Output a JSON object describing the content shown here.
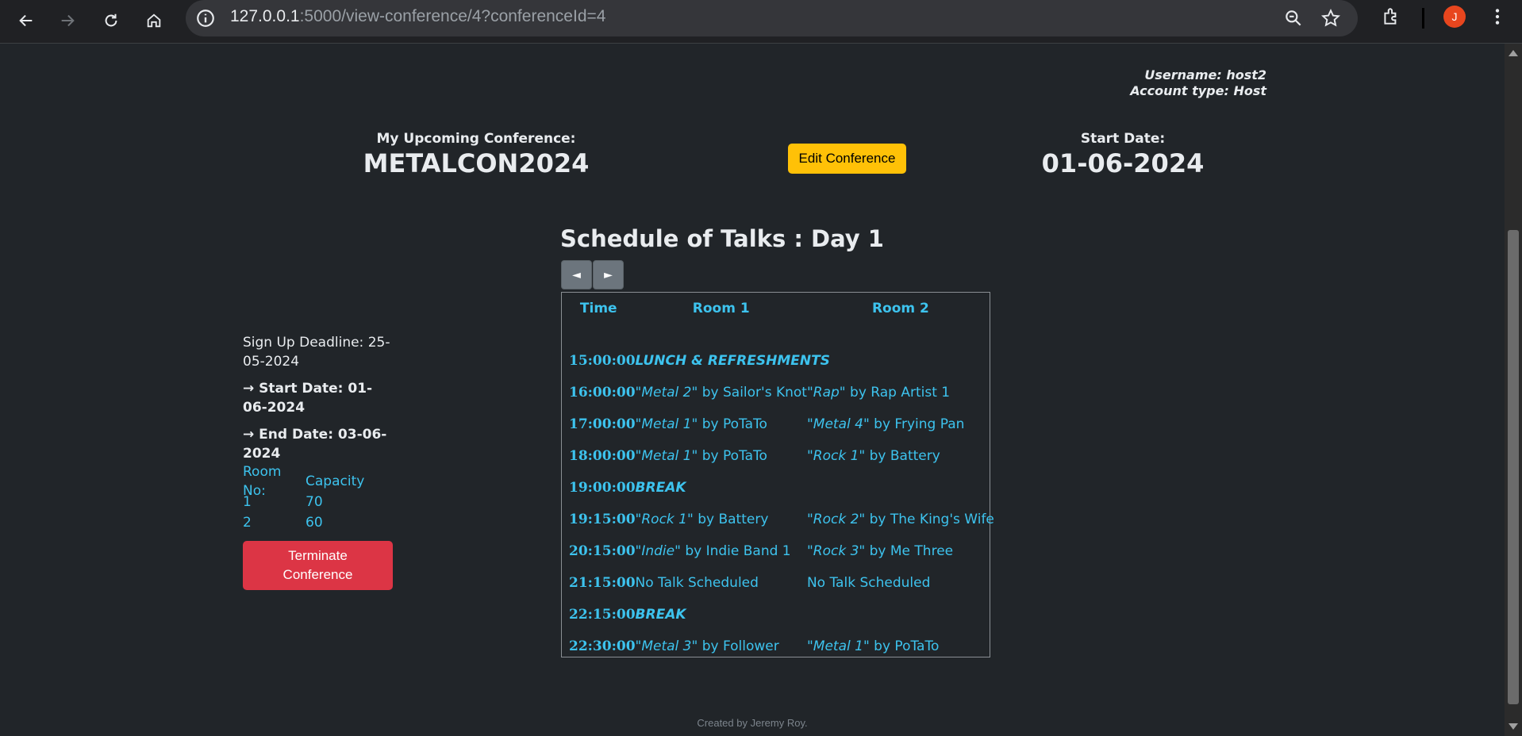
{
  "browser": {
    "url_host": "127.0.0.1",
    "url_path": ":5000/view-conference/4?conferenceId=4",
    "avatar_letter": "J"
  },
  "user": {
    "username": "Username: host2",
    "account_type": "Account type: Host"
  },
  "conference": {
    "label": "My Upcoming Conference:",
    "name": "METALCON2024",
    "edit_label": "Edit Conference",
    "start_label": "Start Date:",
    "start_value": "01-06-2024"
  },
  "schedule": {
    "title": "Schedule of Talks : Day 1",
    "prev_label": "◄",
    "next_label": "►",
    "headers": [
      "Time",
      "Room 1",
      "Room 2"
    ],
    "rows": [
      {
        "time": "15:00:00",
        "special": "LUNCH & REFRESHMENTS"
      },
      {
        "time": "16:00:00",
        "r1_title": "\"Metal 2\"",
        "r1_by": " by Sailor's Knot",
        "r2_title": "\"Rap\"",
        "r2_by": " by Rap Artist 1"
      },
      {
        "time": "17:00:00",
        "r1_title": "\"Metal 1\"",
        "r1_by": " by PoTaTo",
        "r2_title": "\"Metal 4\"",
        "r2_by": " by Frying Pan"
      },
      {
        "time": "18:00:00",
        "r1_title": "\"Metal 1\"",
        "r1_by": " by PoTaTo",
        "r2_title": "\"Rock 1\"",
        "r2_by": " by Battery"
      },
      {
        "time": "19:00:00",
        "special": "BREAK"
      },
      {
        "time": "19:15:00",
        "r1_title": "\"Rock 1\"",
        "r1_by": " by Battery",
        "r2_title": "\"Rock 2\"",
        "r2_by": " by The King's Wife"
      },
      {
        "time": "20:15:00",
        "r1_title": "\"Indie\"",
        "r1_by": " by Indie Band 1",
        "r2_title": "\"Rock 3\"",
        "r2_by": " by Me Three"
      },
      {
        "time": "21:15:00",
        "r1_title": "",
        "r1_by": "No Talk Scheduled",
        "r2_title": "",
        "r2_by": "No Talk Scheduled"
      },
      {
        "time": "22:15:00",
        "special": "BREAK"
      },
      {
        "time": "22:30:00",
        "r1_title": "\"Metal 3\"",
        "r1_by": " by Follower",
        "r2_title": "\"Metal 1\"",
        "r2_by": " by PoTaTo"
      }
    ]
  },
  "sidebar": {
    "signup_deadline": "Sign Up Deadline: 25-05-2024",
    "start_date": "→ Start Date: 01-06-2024",
    "end_date": "→ End Date: 03-06-2024",
    "rooms_header": [
      "Room No:",
      "Capacity"
    ],
    "rooms": [
      {
        "no": "1",
        "capacity": "70"
      },
      {
        "no": "2",
        "capacity": "60"
      }
    ],
    "terminate_label": "Terminate Conference"
  },
  "footer": "Created by Jeremy Roy."
}
